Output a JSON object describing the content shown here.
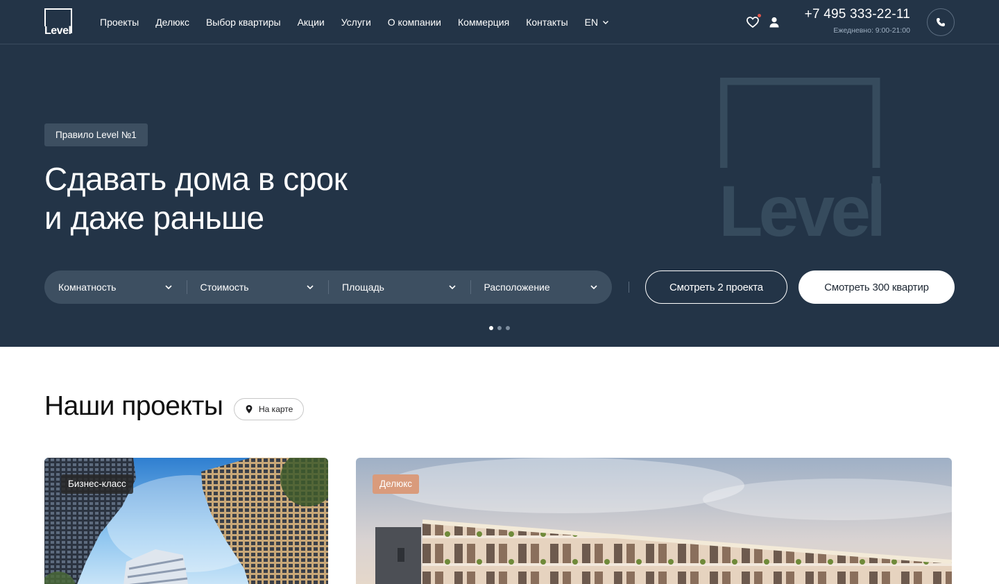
{
  "header": {
    "logo_text": "Level",
    "nav": [
      "Проекты",
      "Делюкс",
      "Выбор квартиры",
      "Акции",
      "Услуги",
      "О компании",
      "Коммерция",
      "Контакты"
    ],
    "lang": "EN",
    "phone": "+7 495 333-22-11",
    "hours": "Ежедневно: 9:00-21:00"
  },
  "hero": {
    "badge": "Правило Level №1",
    "title_line1": "Сдавать дома в срок",
    "title_line2": "и даже раньше",
    "watermark_text": "Level",
    "filters": [
      "Комнатность",
      "Стоимость",
      "Площадь",
      "Расположение"
    ],
    "btn_projects": "Смотреть 2 проекта",
    "btn_flats": "Смотреть 300 квартир",
    "slides": 3,
    "active_slide": 1
  },
  "projects": {
    "title": "Наши проекты",
    "map_button": "На карте",
    "cards": [
      {
        "tag": "Бизнес-класс"
      },
      {
        "tag": "Делюкс"
      }
    ]
  },
  "colors": {
    "navy": "#233447",
    "panel": "#3d4f61",
    "peach": "#d99b7c",
    "white": "#ffffff"
  },
  "icons": [
    "heart-icon",
    "user-icon",
    "phone-icon",
    "chevron-down-icon",
    "map-pin-icon"
  ]
}
